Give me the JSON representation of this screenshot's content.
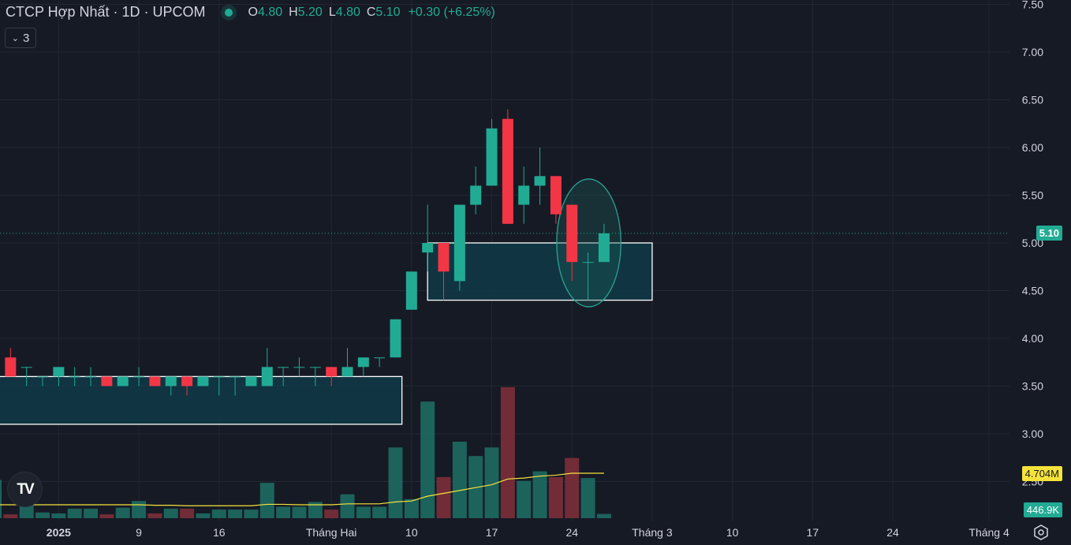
{
  "header": {
    "title": "CTCP Hợp Nhất · 1D · UPCOM",
    "ohlc": {
      "o_label": "O",
      "o": "4.80",
      "h_label": "H",
      "h": "5.20",
      "l_label": "L",
      "l": "4.80",
      "c_label": "C",
      "c": "5.10"
    },
    "change": "+0.30 (+6.25%)",
    "indicators_count": "3"
  },
  "tags": {
    "last_price": "5.10",
    "volume_ma": "4.704M",
    "volume": "446.9K"
  },
  "logo": "TV",
  "colors": {
    "up": "#22ab94",
    "down": "#f23645",
    "vol_up": "#1d6b63",
    "vol_down": "#7c2f3a",
    "ma": "#f5e33b",
    "bg": "#161a25",
    "grid": "#232733",
    "box": "#0f3a46"
  },
  "chart_data": {
    "type": "candlestick",
    "title": "CTCP Hợp Nhất · 1D · UPCOM",
    "ylim": [
      2.25,
      7.5
    ],
    "yticks": [
      "7.50",
      "7.00",
      "6.50",
      "6.00",
      "5.50",
      "5.00",
      "4.50",
      "4.00",
      "3.50",
      "3.00",
      "2.50"
    ],
    "xticks": [
      {
        "index": 4,
        "label": "2025"
      },
      {
        "index": 9,
        "label": "9"
      },
      {
        "index": 14,
        "label": "16"
      },
      {
        "index": 21,
        "label": "Tháng Hai"
      },
      {
        "index": 26,
        "label": "10"
      },
      {
        "index": 31,
        "label": "17"
      },
      {
        "index": 36,
        "label": "24"
      },
      {
        "index": 41,
        "label": "Tháng 3"
      },
      {
        "index": 46,
        "label": "10"
      },
      {
        "index": 51,
        "label": "17"
      },
      {
        "index": 56,
        "label": "24"
      },
      {
        "index": 62,
        "label": "Tháng 4"
      }
    ],
    "candles": [
      [
        3.6,
        3.8,
        3.6,
        3.8
      ],
      [
        3.8,
        3.9,
        3.6,
        3.6
      ],
      [
        3.7,
        3.7,
        3.5,
        3.7
      ],
      [
        3.6,
        3.6,
        3.5,
        3.6
      ],
      [
        3.6,
        3.7,
        3.5,
        3.7
      ],
      [
        3.6,
        3.7,
        3.5,
        3.6
      ],
      [
        3.6,
        3.7,
        3.5,
        3.6
      ],
      [
        3.6,
        3.6,
        3.5,
        3.5
      ],
      [
        3.5,
        3.6,
        3.5,
        3.6
      ],
      [
        3.6,
        3.7,
        3.5,
        3.6
      ],
      [
        3.6,
        3.6,
        3.5,
        3.5
      ],
      [
        3.5,
        3.6,
        3.4,
        3.6
      ],
      [
        3.6,
        3.6,
        3.4,
        3.5
      ],
      [
        3.5,
        3.6,
        3.5,
        3.6
      ],
      [
        3.6,
        3.6,
        3.4,
        3.6
      ],
      [
        3.6,
        3.6,
        3.4,
        3.6
      ],
      [
        3.5,
        3.6,
        3.5,
        3.6
      ],
      [
        3.5,
        3.9,
        3.5,
        3.7
      ],
      [
        3.7,
        3.7,
        3.5,
        3.7
      ],
      [
        3.7,
        3.8,
        3.6,
        3.7
      ],
      [
        3.7,
        3.7,
        3.5,
        3.7
      ],
      [
        3.7,
        3.7,
        3.5,
        3.6
      ],
      [
        3.6,
        3.9,
        3.6,
        3.7
      ],
      [
        3.7,
        3.8,
        3.6,
        3.8
      ],
      [
        3.8,
        3.8,
        3.7,
        3.8
      ],
      [
        3.8,
        4.2,
        3.8,
        4.2
      ],
      [
        4.3,
        4.7,
        4.3,
        4.7
      ],
      [
        4.9,
        5.4,
        4.7,
        5.0
      ],
      [
        5.0,
        5.0,
        4.4,
        4.7
      ],
      [
        4.6,
        5.4,
        4.5,
        5.4
      ],
      [
        5.4,
        5.8,
        5.3,
        5.6
      ],
      [
        5.6,
        6.3,
        5.6,
        6.2
      ],
      [
        6.3,
        6.4,
        5.2,
        5.2
      ],
      [
        5.4,
        5.8,
        5.2,
        5.6
      ],
      [
        5.6,
        6.0,
        5.4,
        5.7
      ],
      [
        5.7,
        5.7,
        5.2,
        5.3
      ],
      [
        5.4,
        5.4,
        4.6,
        4.8
      ],
      [
        4.8,
        4.9,
        4.4,
        4.8
      ],
      [
        4.8,
        5.2,
        4.8,
        5.1
      ]
    ],
    "volume_millions": [
      4.0,
      0.4,
      1.4,
      0.6,
      0.5,
      1.0,
      1.0,
      0.4,
      1.1,
      1.8,
      0.5,
      1.0,
      1.0,
      0.5,
      0.9,
      0.9,
      0.9,
      3.7,
      1.2,
      1.2,
      1.7,
      0.9,
      2.5,
      1.2,
      1.2,
      7.4,
      2.0,
      12.2,
      4.3,
      8.0,
      6.5,
      7.4,
      13.7,
      3.9,
      4.9,
      4.3,
      6.3,
      4.2,
      0.447
    ],
    "volume_ma_millions": [
      1.4,
      1.4,
      1.4,
      1.4,
      1.4,
      1.4,
      1.4,
      1.4,
      1.4,
      1.4,
      1.35,
      1.35,
      1.3,
      1.3,
      1.3,
      1.3,
      1.3,
      1.45,
      1.45,
      1.4,
      1.4,
      1.4,
      1.5,
      1.5,
      1.5,
      1.7,
      1.8,
      2.3,
      2.6,
      2.9,
      3.2,
      3.5,
      4.1,
      4.2,
      4.4,
      4.5,
      4.7,
      4.7,
      4.704
    ],
    "last_price": 5.1,
    "zones": [
      {
        "from_index": -1,
        "to_index": 25.4,
        "low": 3.1,
        "high": 3.6
      },
      {
        "from_index": 27,
        "to_index": 41,
        "low": 4.4,
        "high": 5.0
      }
    ],
    "highlight_ellipse": {
      "center_index": 37,
      "center_price": 5.0,
      "span_bars": 4,
      "price_low": 4.33,
      "price_high": 5.67
    }
  }
}
